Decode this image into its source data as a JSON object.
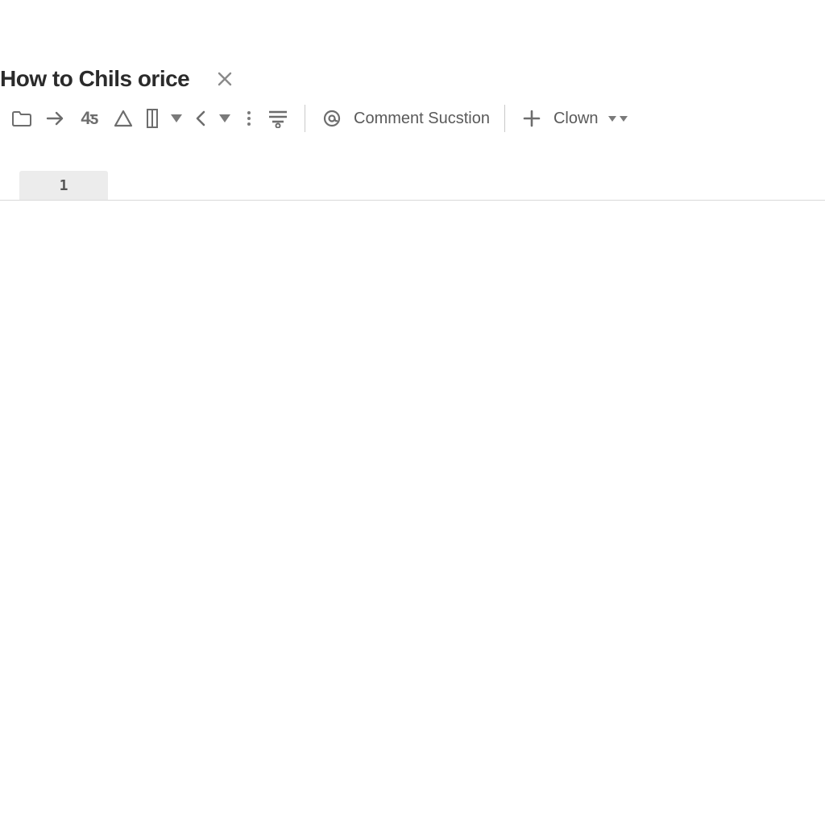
{
  "title": "How to Chils orice",
  "toolbar": {
    "font_glyph": "4ƽ",
    "comment_label": "Comment Sucstion",
    "clown_label": "Clown"
  },
  "row": {
    "number": "1"
  }
}
